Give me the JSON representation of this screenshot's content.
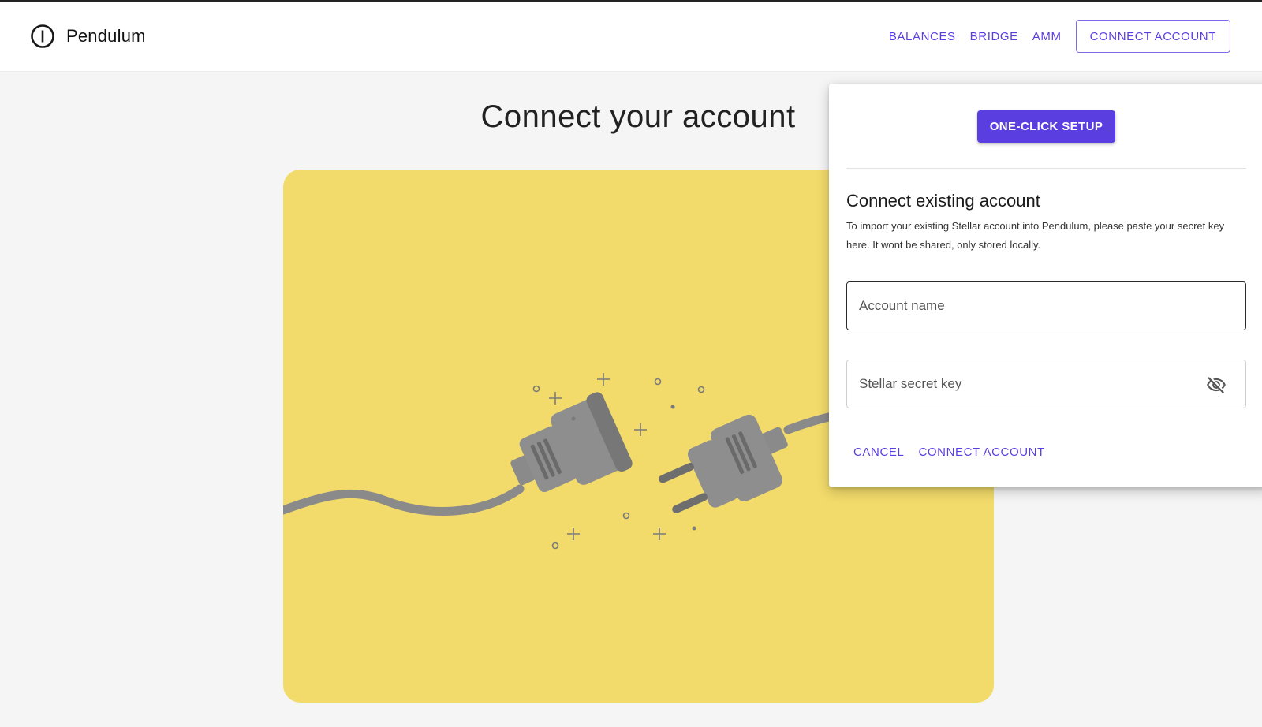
{
  "brand": {
    "name": "Pendulum"
  },
  "nav": {
    "links": [
      {
        "label": "BALANCES"
      },
      {
        "label": "BRIDGE"
      },
      {
        "label": "AMM"
      }
    ],
    "connect_label": "CONNECT ACCOUNT"
  },
  "main": {
    "title": "Connect your account",
    "illustration_icon": "unplugged-cable-illustration",
    "illustration_color": "#f2db6b"
  },
  "popover": {
    "one_click_label": "ONE-CLICK SETUP",
    "section_title": "Connect existing account",
    "section_desc": "To import your existing Stellar account into Pendulum, please paste your secret key here. It wont be shared, only stored locally.",
    "account_name": {
      "placeholder": "Account name",
      "value": ""
    },
    "secret_key": {
      "placeholder": "Stellar secret key",
      "value": "",
      "toggle_icon": "eye-off-icon"
    },
    "cancel_label": "CANCEL",
    "connect_label": "CONNECT ACCOUNT"
  },
  "colors": {
    "accent": "#5b3ee0",
    "background": "#f5f5f5",
    "illustration_bg": "#f2db6b",
    "plug_gray": "#8a8a8a"
  }
}
